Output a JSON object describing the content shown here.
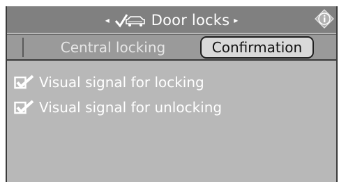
{
  "header": {
    "title": "Door locks",
    "nav_left_glyph": "◂",
    "nav_right_glyph": "▸",
    "car_icon": "car-lock-icon",
    "info_icon": "info-icon"
  },
  "tabs": [
    {
      "label": "Central locking",
      "active": false
    },
    {
      "label": "Confirmation",
      "active": true
    }
  ],
  "options": [
    {
      "label": "Visual signal for locking",
      "checked": true
    },
    {
      "label": "Visual signal for unlocking",
      "checked": true
    }
  ],
  "colors": {
    "background": "#b8b8b8",
    "title_bar": "#808080",
    "active_tab": "#d9d9d9",
    "text": "#ffffff"
  }
}
